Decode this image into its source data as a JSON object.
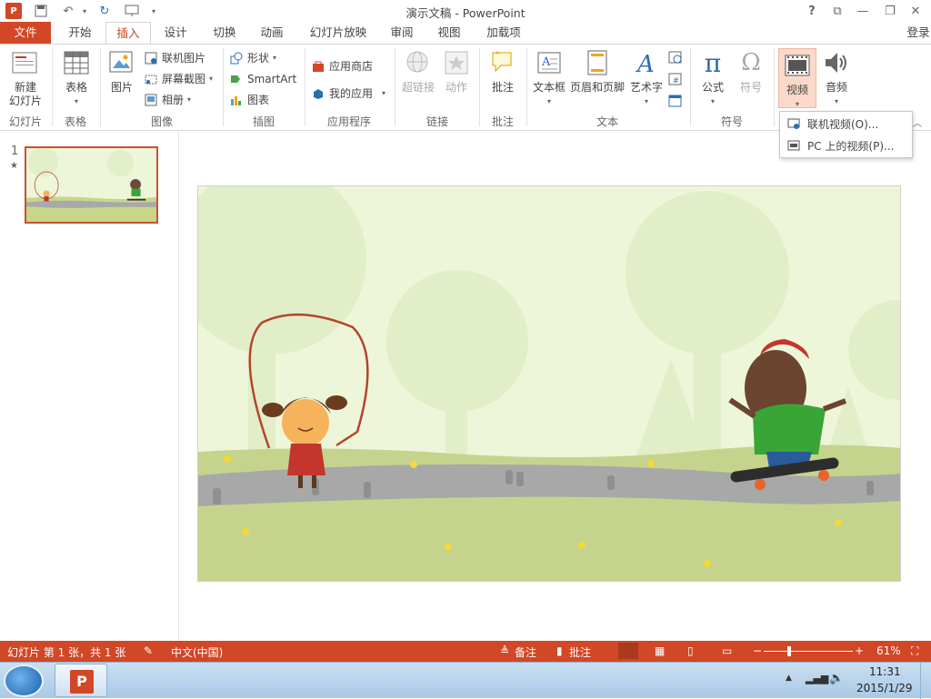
{
  "app": {
    "title": "演示文稿 - PowerPoint",
    "quick_access": [
      "save-icon",
      "undo-icon",
      "redo-icon",
      "present-from-start-icon",
      "customize-icon"
    ],
    "window_controls": {
      "help": "?",
      "restore_ribbon": "⧉",
      "minimize": "—",
      "maximize": "❐",
      "close": "✕"
    },
    "login": "登录"
  },
  "tabs": [
    "文件",
    "开始",
    "插入",
    "设计",
    "切换",
    "动画",
    "幻灯片放映",
    "审阅",
    "视图",
    "加载项"
  ],
  "ribbon": {
    "slides": {
      "new_slide": "新建\n幻灯片",
      "group": "幻灯片"
    },
    "tables": {
      "table": "表格",
      "group": "表格"
    },
    "images": {
      "picture": "图片",
      "online_picture": "联机图片",
      "screenshot": "屏幕截图",
      "album": "相册",
      "group": "图像"
    },
    "illustrations": {
      "shapes": "形状",
      "smartart": "SmartArt",
      "chart": "图表",
      "group": "插图"
    },
    "apps": {
      "store": "应用商店",
      "my_apps": "我的应用",
      "group": "应用程序"
    },
    "links": {
      "hyperlink": "超链接",
      "action": "动作",
      "group": "链接"
    },
    "comments": {
      "comment": "批注",
      "group": "批注"
    },
    "text": {
      "textbox": "文本框",
      "header_footer": "页眉和页脚",
      "wordart": "艺术字",
      "group": "文本"
    },
    "symbols": {
      "equation": "公式",
      "symbol": "符号",
      "group": "符号"
    },
    "media": {
      "video": "视频",
      "audio": "音频"
    }
  },
  "video_menu": {
    "online_video": "联机视频(O)...",
    "pc_video": "PC 上的视频(P)..."
  },
  "slides_pane": {
    "number": "1",
    "star": "★"
  },
  "status": {
    "slide_info": "幻灯片 第 1 张，共 1 张",
    "language": "中文(中国)",
    "notes": "备注",
    "comments": "批注",
    "zoom": "61%",
    "zoom_level": 0.61
  },
  "taskbar": {
    "time": "11:31",
    "date": "2015/1/29"
  },
  "colors": {
    "accent": "#d24726",
    "ribbon_active": "#c43e1c",
    "slide_bg": "#eef6d9"
  }
}
